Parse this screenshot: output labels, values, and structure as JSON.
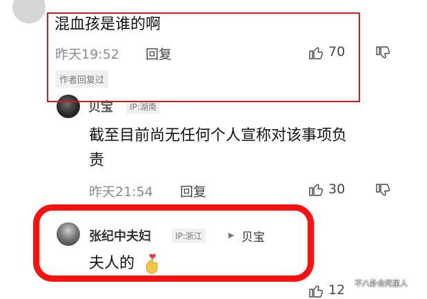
{
  "comments": [
    {
      "text": "混血孩是谁的啊",
      "time": "昨天19:52",
      "reply_label": "回复",
      "likes": "70",
      "author_tag": "作者回复过"
    },
    {
      "user": "贝宝",
      "ip": "IP:湖南",
      "text_line1": "截至目前尚无任何个人宣称对该事项负",
      "text_line2": "责",
      "time": "昨天21:54",
      "reply_label": "回复",
      "likes": "30"
    },
    {
      "user": "张纪中夫妇",
      "ip": "IP:浙江",
      "reply_to": "贝宝",
      "text": "夫人的",
      "likes": "12"
    }
  ],
  "watermark": "不八卦会死星人",
  "colors": {
    "highlight_thin": "#c91d1d",
    "highlight_thick": "#ff1010"
  }
}
